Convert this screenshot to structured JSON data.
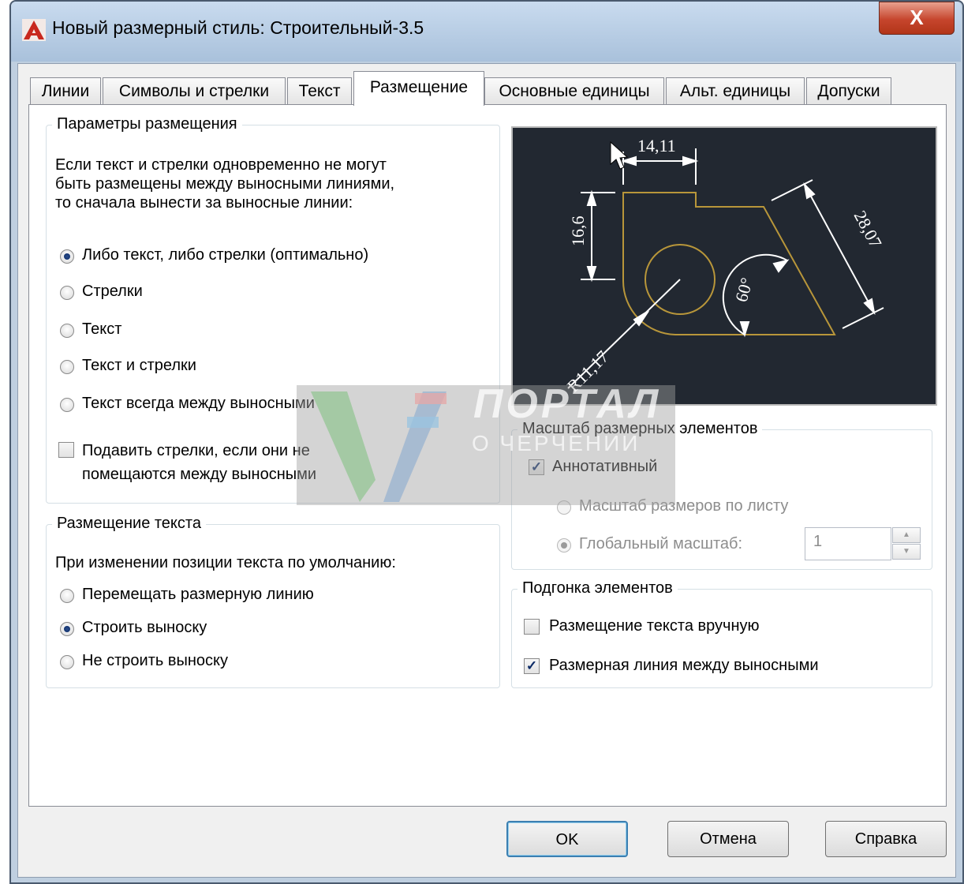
{
  "window": {
    "title": "Новый размерный стиль: Строительный-3.5",
    "close_label": "X",
    "icon": "autocad-app-icon"
  },
  "tabs": [
    {
      "label": "Линии",
      "active": false
    },
    {
      "label": "Символы и стрелки",
      "active": false
    },
    {
      "label": "Текст",
      "active": false
    },
    {
      "label": "Размещение",
      "active": true
    },
    {
      "label": "Основные единицы",
      "active": false
    },
    {
      "label": "Альт. единицы",
      "active": false
    },
    {
      "label": "Допуски",
      "active": false
    }
  ],
  "fit_options": {
    "legend": "Параметры размещения",
    "description": [
      "Если текст и стрелки одновременно не могут",
      "быть размещены между выносными линиями,",
      "то сначала вынести за выносные линии:"
    ],
    "options": [
      {
        "label": "Либо текст, либо стрелки (оптимально)",
        "selected": true
      },
      {
        "label": "Стрелки",
        "selected": false
      },
      {
        "label": "Текст",
        "selected": false
      },
      {
        "label": "Текст и стрелки",
        "selected": false
      },
      {
        "label": "Текст всегда между выносными",
        "selected": false
      }
    ],
    "suppress_arrows": {
      "label_line1": "Подавить стрелки, если они не",
      "label_line2": "помещаются между выносными",
      "checked": false
    }
  },
  "text_placement": {
    "legend": "Размещение текста",
    "description": "При изменении позиции текста по умолчанию:",
    "options": [
      {
        "label": "Перемещать размерную линию",
        "selected": false
      },
      {
        "label": "Строить выноску",
        "selected": true
      },
      {
        "label": "Не строить выноску",
        "selected": false
      }
    ]
  },
  "preview": {
    "dim_top": "14,11",
    "dim_left": "16,6",
    "dim_right": "28,07",
    "dim_angle": "60°",
    "dim_radius": "R11,17",
    "bg_color": "#222831",
    "geometry_color": "#b8963a"
  },
  "scale": {
    "legend": "Масштаб размерных элементов",
    "annotative_label": "Аннотативный",
    "annotative_checked": true,
    "options": [
      {
        "label": "Масштаб размеров по листу",
        "selected": false
      },
      {
        "label": "Глобальный масштаб:",
        "selected": true
      }
    ],
    "global_scale_value": "1"
  },
  "fine_tuning": {
    "legend": "Подгонка элементов",
    "options": [
      {
        "label": "Размещение текста вручную",
        "checked": false
      },
      {
        "label": "Размерная линия между выносными",
        "checked": true
      }
    ]
  },
  "buttons": {
    "ok": "OK",
    "cancel": "Отмена",
    "help": "Справка"
  },
  "watermark": {
    "line1": "ПОРТАЛ",
    "line2": "О ЧЕРЧЕНИИ"
  }
}
